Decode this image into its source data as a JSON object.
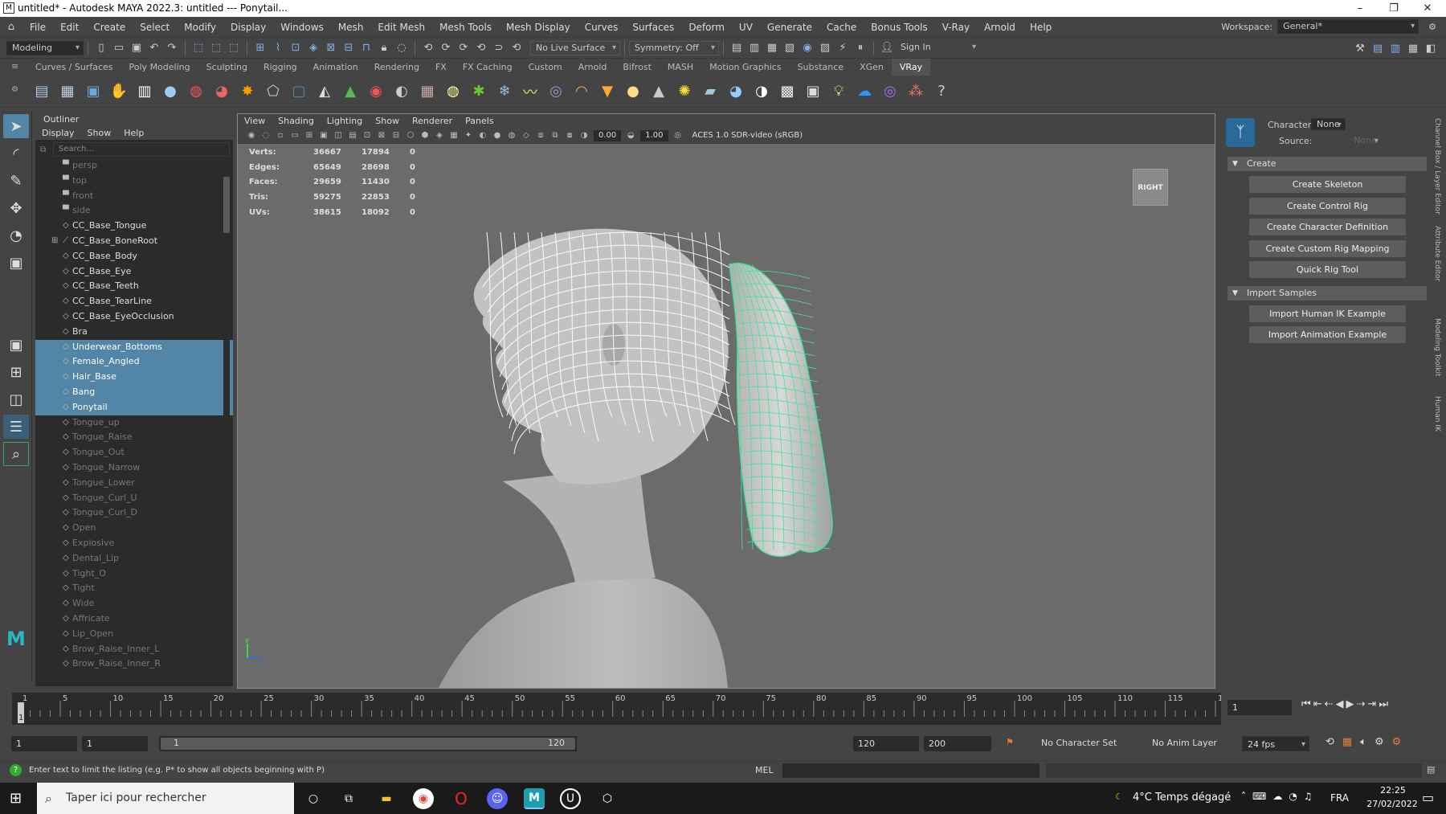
{
  "window": {
    "title": "untitled* - Autodesk MAYA 2022.3: untitled   ---   Ponytail...",
    "minimize": "–",
    "maximize": "❐",
    "close": "✕"
  },
  "menubar": {
    "items": [
      "File",
      "Edit",
      "Create",
      "Select",
      "Modify",
      "Display",
      "Windows",
      "Mesh",
      "Edit Mesh",
      "Mesh Tools",
      "Mesh Display",
      "Curves",
      "Surfaces",
      "Deform",
      "UV",
      "Generate",
      "Cache",
      "Bonus Tools",
      "V-Ray",
      "Arnold",
      "Help"
    ],
    "workspace_label": "Workspace:",
    "workspace_value": "General*"
  },
  "statusline": {
    "mode": "Modeling",
    "live_surface": "No Live Surface",
    "symmetry": "Symmetry: Off",
    "sign_in": "Sign In"
  },
  "shelf_tabs": {
    "items": [
      "Curves / Surfaces",
      "Poly Modeling",
      "Sculpting",
      "Rigging",
      "Animation",
      "Rendering",
      "FX",
      "FX Caching",
      "Custom",
      "Arnold",
      "Bifrost",
      "MASH",
      "Motion Graphics",
      "Substance",
      "XGen",
      "VRay"
    ],
    "active": "VRay"
  },
  "outliner": {
    "title": "Outliner",
    "menu": [
      "Display",
      "Show",
      "Help"
    ],
    "search_placeholder": "Search...",
    "items": [
      {
        "label": "persp",
        "state": "dim",
        "icon": "camera-icon"
      },
      {
        "label": "top",
        "state": "dim",
        "icon": "camera-icon"
      },
      {
        "label": "front",
        "state": "dim",
        "icon": "camera-icon"
      },
      {
        "label": "side",
        "state": "dim",
        "icon": "camera-icon"
      },
      {
        "label": "CC_Base_Tongue",
        "state": "normal",
        "icon": "mesh-icon"
      },
      {
        "label": "CC_Base_BoneRoot",
        "state": "normal",
        "icon": "joint-icon"
      },
      {
        "label": "CC_Base_Body",
        "state": "normal",
        "icon": "mesh-icon"
      },
      {
        "label": "CC_Base_Eye",
        "state": "normal",
        "icon": "mesh-icon"
      },
      {
        "label": "CC_Base_Teeth",
        "state": "normal",
        "icon": "mesh-icon"
      },
      {
        "label": "CC_Base_TearLine",
        "state": "normal",
        "icon": "mesh-icon"
      },
      {
        "label": "CC_Base_EyeOcclusion",
        "state": "normal",
        "icon": "mesh-icon"
      },
      {
        "label": "Bra",
        "state": "normal",
        "icon": "mesh-icon"
      },
      {
        "label": "Underwear_Bottoms",
        "state": "selected",
        "icon": "mesh-icon"
      },
      {
        "label": "Female_Angled",
        "state": "selected",
        "icon": "mesh-icon"
      },
      {
        "label": "Hair_Base",
        "state": "selected",
        "icon": "mesh-icon"
      },
      {
        "label": "Bang",
        "state": "selected",
        "icon": "mesh-icon"
      },
      {
        "label": "Ponytail",
        "state": "selected",
        "icon": "mesh-icon"
      },
      {
        "label": "Tongue_up",
        "state": "dim",
        "icon": "mesh-icon"
      },
      {
        "label": "Tongue_Raise",
        "state": "dim",
        "icon": "mesh-icon"
      },
      {
        "label": "Tongue_Out",
        "state": "dim",
        "icon": "mesh-icon"
      },
      {
        "label": "Tongue_Narrow",
        "state": "dim",
        "icon": "mesh-icon"
      },
      {
        "label": "Tongue_Lower",
        "state": "dim",
        "icon": "mesh-icon"
      },
      {
        "label": "Tongue_Curl_U",
        "state": "dim",
        "icon": "mesh-icon"
      },
      {
        "label": "Tongue_Curl_D",
        "state": "dim",
        "icon": "mesh-icon"
      },
      {
        "label": "Open",
        "state": "dim",
        "icon": "mesh-icon"
      },
      {
        "label": "Explosive",
        "state": "dim",
        "icon": "mesh-icon"
      },
      {
        "label": "Dental_Lip",
        "state": "dim",
        "icon": "mesh-icon"
      },
      {
        "label": "Tight_O",
        "state": "dim",
        "icon": "mesh-icon"
      },
      {
        "label": "Tight",
        "state": "dim",
        "icon": "mesh-icon"
      },
      {
        "label": "Wide",
        "state": "dim",
        "icon": "mesh-icon"
      },
      {
        "label": "Affricate",
        "state": "dim",
        "icon": "mesh-icon"
      },
      {
        "label": "Lip_Open",
        "state": "dim",
        "icon": "mesh-icon"
      },
      {
        "label": "Brow_Raise_Inner_L",
        "state": "dim",
        "icon": "mesh-icon"
      },
      {
        "label": "Brow_Raise_Inner_R",
        "state": "dim",
        "icon": "mesh-icon"
      }
    ]
  },
  "viewport": {
    "menu": [
      "View",
      "Shading",
      "Lighting",
      "Show",
      "Renderer",
      "Panels"
    ],
    "exposure": "0.00",
    "gamma": "1.00",
    "color_space": "ACES 1.0 SDR-video (sRGB)",
    "view_cube": "RIGHT",
    "hud": [
      {
        "label": "Verts:",
        "a": "36667",
        "b": "17894",
        "c": "0"
      },
      {
        "label": "Edges:",
        "a": "65649",
        "b": "28698",
        "c": "0"
      },
      {
        "label": "Faces:",
        "a": "29659",
        "b": "11430",
        "c": "0"
      },
      {
        "label": "Tris:",
        "a": "59275",
        "b": "22853",
        "c": "0"
      },
      {
        "label": "UVs:",
        "a": "38615",
        "b": "18092",
        "c": "0"
      }
    ]
  },
  "human_ik": {
    "character_label": "Character:",
    "character_value": "None",
    "source_label": "Source:",
    "source_value": "None",
    "sections": [
      {
        "title": "Create",
        "buttons": [
          "Create Skeleton",
          "Create Control Rig",
          "Create Character Definition",
          "Create Custom Rig Mapping",
          "Quick Rig Tool"
        ]
      },
      {
        "title": "Import Samples",
        "buttons": [
          "Import Human IK Example",
          "Import Animation Example"
        ]
      }
    ],
    "side_tabs": [
      "Channel Box / Layer Editor",
      "Attribute Editor",
      "Modeling Toolkit",
      "Human IK"
    ]
  },
  "timeline": {
    "ticks": [
      "1",
      "5",
      "10",
      "15",
      "20",
      "25",
      "30",
      "35",
      "40",
      "45",
      "50",
      "55",
      "60",
      "65",
      "70",
      "75",
      "80",
      "85",
      "90",
      "95",
      "100",
      "105",
      "110",
      "115",
      "120"
    ],
    "current_frame": "1",
    "range_start": "1",
    "playback_start": "1",
    "slider_start": "1",
    "slider_end": "120",
    "playback_end": "120",
    "range_end": "200",
    "character_set": "No Character Set",
    "anim_layer": "No Anim Layer",
    "fps": "24 fps"
  },
  "helpline": {
    "text": "Enter text to limit the listing (e.g. P* to show all objects beginning with P)",
    "script_lang": "MEL"
  },
  "taskbar": {
    "search_placeholder": "Taper ici pour rechercher",
    "weather": "4°C  Temps dégagé",
    "lang": "FRA",
    "time": "22:25",
    "date": "27/02/2022"
  },
  "colors": {
    "selection": "#5285a6",
    "wireframe": "#ffffff",
    "wireframe_selected": "#43e29a",
    "viewport_bg": "#6b6b6b"
  }
}
